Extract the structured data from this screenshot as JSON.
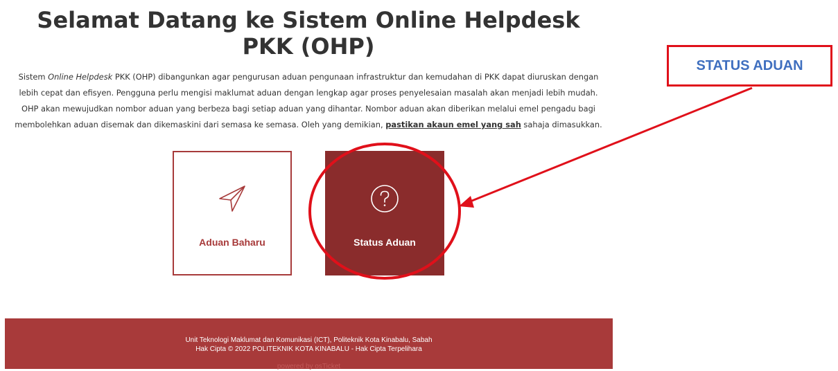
{
  "header": {
    "title": "Selamat Datang ke Sistem Online Helpdesk PKK (OHP)"
  },
  "intro": {
    "part1": "Sistem ",
    "italic": "Online Helpdesk",
    "part2": " PKK (OHP) dibangunkan agar pengurusan aduan pengunaan infrastruktur dan kemudahan di PKK dapat diuruskan dengan lebih cepat dan efisyen. Pengguna perlu mengisi maklumat aduan dengan lengkap agar proses penyelesaian masalah akan menjadi lebih mudah. OHP akan mewujudkan nombor aduan yang berbeza bagi setiap aduan yang dihantar. Nombor aduan akan diberikan melalui emel pengadu bagi membolehkan aduan disemak dan dikemaskini dari semasa ke semasa. Oleh yang demikian, ",
    "emphasis": "pastikan akaun emel yang sah",
    "part3": " sahaja dimasukkan."
  },
  "tiles": {
    "new_ticket": {
      "label": "Aduan Baharu",
      "icon": "paper-plane-icon"
    },
    "check_status": {
      "label": "Status Aduan",
      "icon": "question-circle-icon"
    }
  },
  "footer": {
    "line1": "Unit Teknologi Maklumat dan Komunikasi (ICT), Politeknik Kota Kinabalu, Sabah",
    "line2": "Hak Cipta © 2022 POLITEKNIK KOTA KINABALU - Hak Cipta Terpelihara",
    "powered": "powered by osTicket"
  },
  "annotation": {
    "callout_label": "STATUS ADUAN"
  },
  "colors": {
    "brand": "#a83a3a",
    "tile_dark": "#8a2c2c",
    "annotation_red": "#e0101a",
    "annotation_text": "#3f6fbf"
  }
}
